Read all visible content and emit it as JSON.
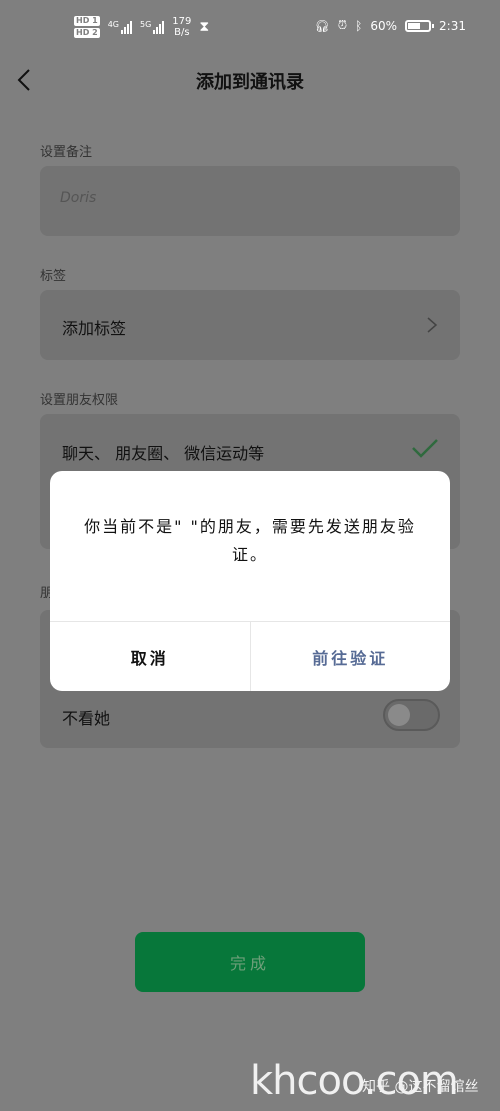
{
  "status_bar": {
    "hd1": "HD 1",
    "hd2": "HD 2",
    "sim1_tag": "4G",
    "sim2_tag": "5G",
    "speed_value": "179",
    "speed_unit": "B/s",
    "battery": "60%",
    "battery_level": 0.6,
    "time": "2:31"
  },
  "nav": {
    "title": "添加到通讯录"
  },
  "remark": {
    "label": "设置备注",
    "placeholder": "Doris"
  },
  "tags": {
    "label": "标签",
    "value": "添加标签"
  },
  "permissions": {
    "label": "设置朋友权限",
    "option_selected": "聊天、 朋友圈、 微信运动等",
    "partial_label": "朋",
    "dont_view": "不看她"
  },
  "dialog": {
    "message": "你当前不是\"  \"的朋友，需要先发送朋友验证。",
    "cancel": "取消",
    "confirm": "前往验证"
  },
  "done_button": "完成",
  "watermark": {
    "site": "khcoo.com",
    "credit": "知乎 @这不溜馆丝"
  }
}
